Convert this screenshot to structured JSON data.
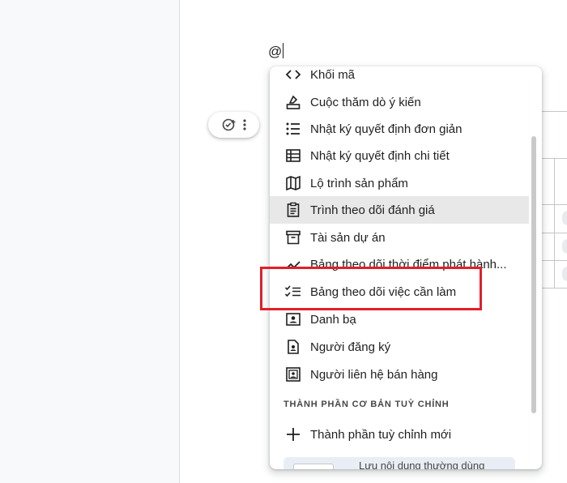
{
  "editor": {
    "typed_text": "@"
  },
  "menu": {
    "items": [
      {
        "label": "Khối mã",
        "icon": "code-icon"
      },
      {
        "label": "Cuộc thăm dò ý kiến",
        "icon": "poll-icon"
      },
      {
        "label": "Nhật ký quyết định đơn giản",
        "icon": "list-icon"
      },
      {
        "label": "Nhật ký quyết định chi tiết",
        "icon": "table-icon"
      },
      {
        "label": "Lộ trình sản phẩm",
        "icon": "map-icon"
      },
      {
        "label": "Trình theo dõi đánh giá",
        "icon": "clipboard-icon"
      },
      {
        "label": "Tài sản dự án",
        "icon": "archive-icon"
      },
      {
        "label": "Bảng theo dõi thời điểm phát hành...",
        "icon": "trend-icon"
      },
      {
        "label": "Bảng theo dõi việc cần làm",
        "icon": "checklist-icon"
      },
      {
        "label": "Danh bạ",
        "icon": "contact-card-icon"
      },
      {
        "label": "Người đăng ký",
        "icon": "person-doc-icon"
      },
      {
        "label": "Người liên hệ bán hàng",
        "icon": "person-frame-icon"
      }
    ],
    "highlighted_item": "Trình theo dõi đánh giá",
    "section_heading": "THÀNH PHẦN CƠ BẢN TUỲ CHỈNH",
    "new_component_label": "Thành phần tuỳ chỉnh mới",
    "saved_content_label": "Lưu nội dung thường dùng"
  },
  "annotation": {
    "color": "#e0202a",
    "target_item": "Bảng theo dõi việc cần làm"
  }
}
